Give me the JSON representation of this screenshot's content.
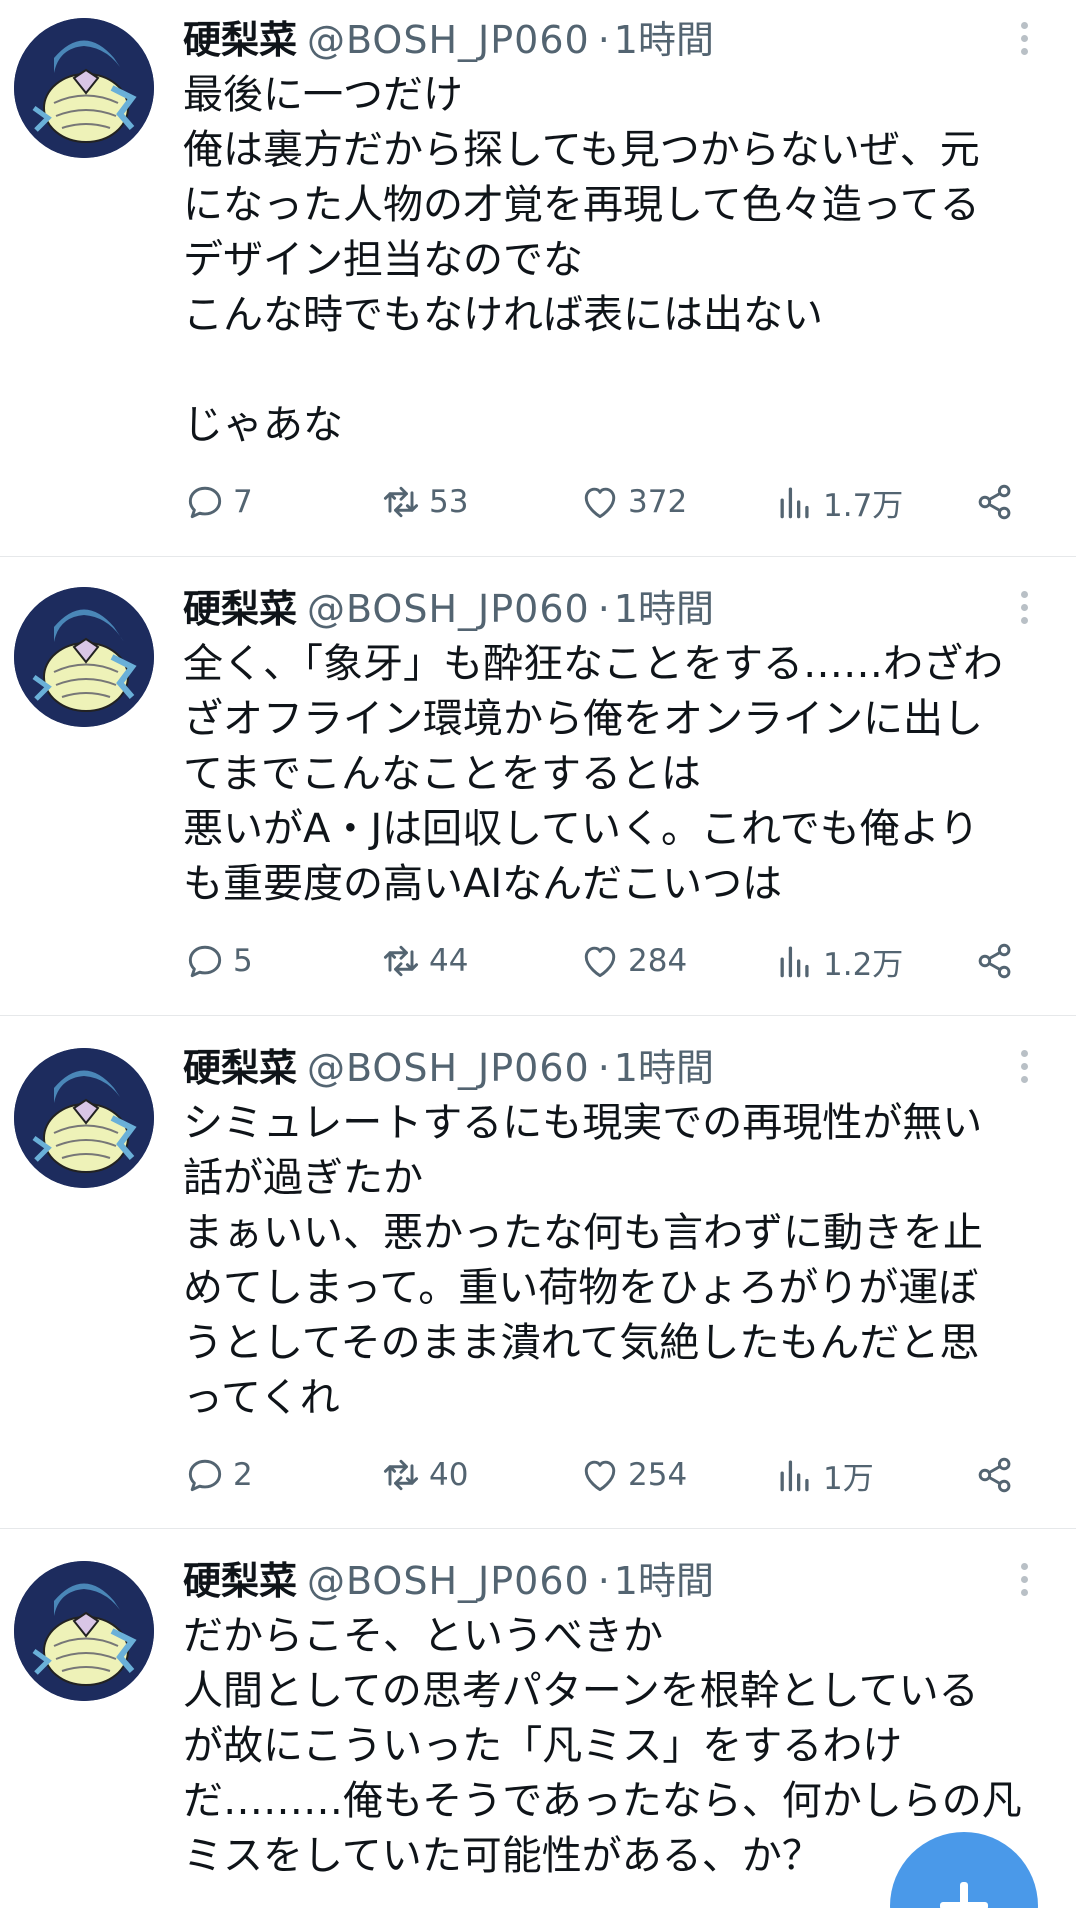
{
  "colors": {
    "accent": "#4a99e9",
    "text": "#0f1419",
    "muted": "#536471",
    "avatar_bg": "#1d2c5e"
  },
  "icons": {
    "reply": "reply-icon",
    "retweet": "retweet-icon",
    "like": "heart-icon",
    "views": "views-icon",
    "share": "share-icon",
    "more": "more-vertical-icon",
    "compose": "plus-icon"
  },
  "tweets": [
    {
      "name": "硬梨菜",
      "handle": "@BOSH_JP060",
      "separator": "·",
      "time": "1時間",
      "lines": [
        "最後に一つだけ",
        "俺は裏方だから探しても見つからないぜ、元",
        "になった人物の才覚を再現して色々造ってる",
        "デザイン担当なのでな",
        "こんな時でもなければ表には出ない",
        "",
        "じゃあな"
      ],
      "replies": "7",
      "retweets": "53",
      "likes": "372",
      "views": "1.7万"
    },
    {
      "name": "硬梨菜",
      "handle": "@BOSH_JP060",
      "separator": "·",
      "time": "1時間",
      "lines": [
        "全く、「象牙」も酔狂なことをする……わざわ",
        "ざオフライン環境から俺をオンラインに出し",
        "てまでこんなことをするとは",
        "悪いがA・Jは回収していく。これでも俺より",
        "も重要度の高いAIなんだこいつは"
      ],
      "replies": "5",
      "retweets": "44",
      "likes": "284",
      "views": "1.2万"
    },
    {
      "name": "硬梨菜",
      "handle": "@BOSH_JP060",
      "separator": "·",
      "time": "1時間",
      "lines": [
        "シミュレートするにも現実での再現性が無い",
        "話が過ぎたか",
        "まぁいい、悪かったな何も言わずに動きを止",
        "めてしまって。重い荷物をひょろがりが運ぼ",
        "うとしてそのまま潰れて気絶したもんだと思",
        "ってくれ"
      ],
      "replies": "2",
      "retweets": "40",
      "likes": "254",
      "views": "1万"
    },
    {
      "name": "硬梨菜",
      "handle": "@BOSH_JP060",
      "separator": "·",
      "time": "1時間",
      "lines": [
        "だからこそ、というべきか",
        "人間としての思考パターンを根幹としている",
        "が故にこういった「凡ミス」をするわけ",
        "だ………俺もそうであったなら、何かしらの凡",
        "ミスをしていた可能性がある、か？"
      ]
    }
  ]
}
